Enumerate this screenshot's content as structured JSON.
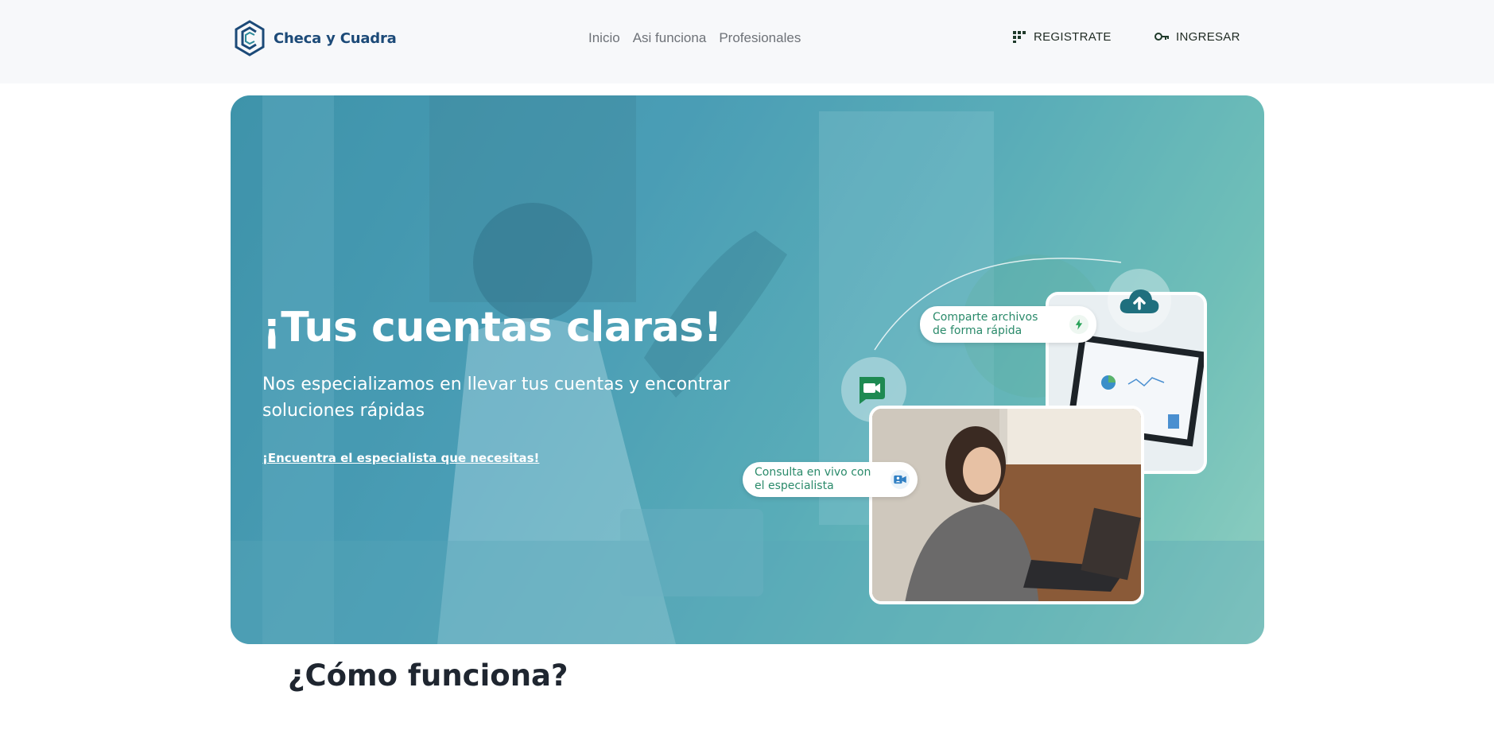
{
  "header": {
    "brand_name": "Checa y Cuadra",
    "logo_icon": "hexagon-c-logo",
    "nav": [
      {
        "label": "Inicio"
      },
      {
        "label": "Asi funciona"
      },
      {
        "label": "Profesionales"
      }
    ],
    "register_label": "REGISTRATE",
    "register_icon": "grid-icon",
    "login_label": "INGRESAR",
    "login_icon": "key-icon"
  },
  "hero": {
    "title": "¡Tus cuentas claras!",
    "subtitle": "Nos especializamos en llevar tus cuentas y encontrar soluciones rápidas",
    "cta": "¡Encuentra el especialista que necesitas!",
    "pill_share_line1": "Comparte archivos",
    "pill_share_line2": "de forma rápida",
    "pill_consult_line1": "Consulta en vivo con",
    "pill_consult_line2": "el especialista",
    "icons": [
      "cloud-upload-icon",
      "video-call-icon",
      "lightning-icon",
      "video-person-icon"
    ]
  },
  "section": {
    "title": "¿Cómo funciona?"
  },
  "colors": {
    "brand": "#1c4a78",
    "accent_green": "#2a8a6a",
    "hero_teal": "#4a9db5",
    "hero_mint": "#a7dfc4"
  }
}
